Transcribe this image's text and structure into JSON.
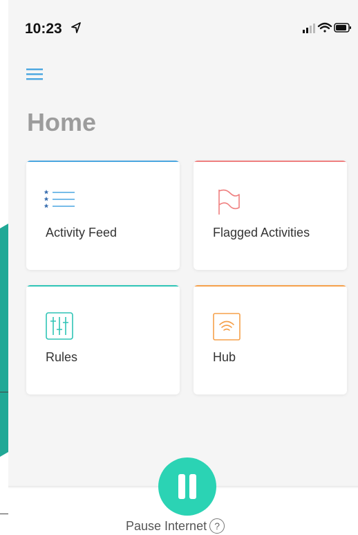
{
  "status_bar": {
    "time": "10:23"
  },
  "page": {
    "title": "Home"
  },
  "cards": [
    {
      "label": "Activity Feed",
      "accent": "#4aa6e0",
      "icon": "list-icon"
    },
    {
      "label": "Flagged Activities",
      "accent": "#ef7f7f",
      "icon": "flag-icon"
    },
    {
      "label": "Rules",
      "accent": "#2ec4b6",
      "icon": "sliders-icon"
    },
    {
      "label": "Hub",
      "accent": "#f5a04a",
      "icon": "wifi-hub-icon"
    }
  ],
  "bottom": {
    "pause_label": "Pause Internet",
    "help": "?"
  },
  "colors": {
    "accent_teal": "#2bd3b4",
    "background": "#f5f5f5",
    "menu_blue": "#4aa6e0"
  }
}
